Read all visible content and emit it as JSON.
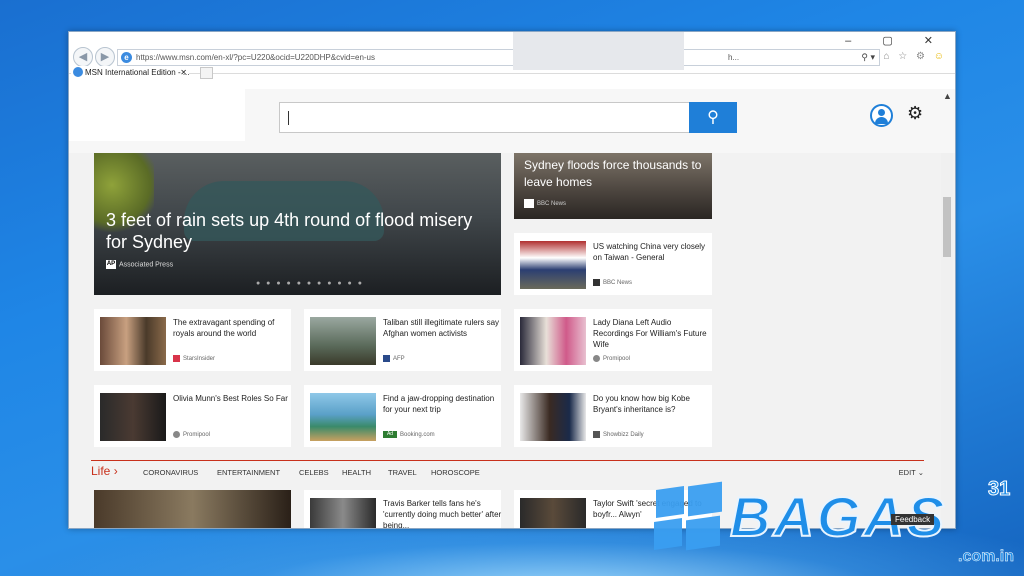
{
  "browser": {
    "url": "https://www.msn.com/en-xl/?pc=U220&ocid=U220DHP&cvid=en-us",
    "url_tail": "h...",
    "tab_title": "MSN International Edition - ...",
    "window_controls": "–  ▢  ✕"
  },
  "header": {
    "search_placeholder": "",
    "search_icon": "magnifier-icon",
    "account_icon": "user-icon",
    "settings_icon": "gear-icon"
  },
  "hero": {
    "title": "3 feet of rain sets up 4th round of flood misery for Sydney",
    "source": "Associated Press",
    "badge": "AP"
  },
  "hero2": {
    "title": "Sydney floods force thousands to leave homes",
    "source": "BBC News"
  },
  "cards": [
    {
      "headline": "US watching China very closely on Taiwan - General",
      "source": "BBC News"
    },
    {
      "headline": "The extravagant spending of royals around the world",
      "source": "StarsInsider"
    },
    {
      "headline": "Taliban still illegitimate rulers say Afghan women activists",
      "source": "AFP"
    },
    {
      "headline": "Lady Diana Left Audio Recordings For William's Future Wife",
      "source": "Promipool"
    },
    {
      "headline": "Olivia Munn's Best Roles So Far",
      "source": "Promipool"
    },
    {
      "headline": "Find a jaw-dropping destination for your next trip",
      "source": "Booking.com",
      "ad": "Ad"
    },
    {
      "headline": "Do you know how big Kobe Bryant's inheritance is?",
      "source": "Showbizz Daily"
    },
    {
      "headline": "Travis Barker tells fans he's 'currently doing much better' after being...",
      "source": ""
    },
    {
      "headline": "Taylor Swift 'secret engaged to boyfr... Alwyn'",
      "source": ""
    }
  ],
  "life_nav": {
    "title": "Life",
    "items": [
      "CORONAVIRUS",
      "ENTERTAINMENT",
      "CELEBS",
      "HEALTH",
      "TRAVEL",
      "HOROSCOPE"
    ],
    "edit": "EDIT"
  },
  "watermark": {
    "text": "BAGAS",
    "number": "31",
    "domain": ".com.in",
    "feedback": "Feedback"
  }
}
